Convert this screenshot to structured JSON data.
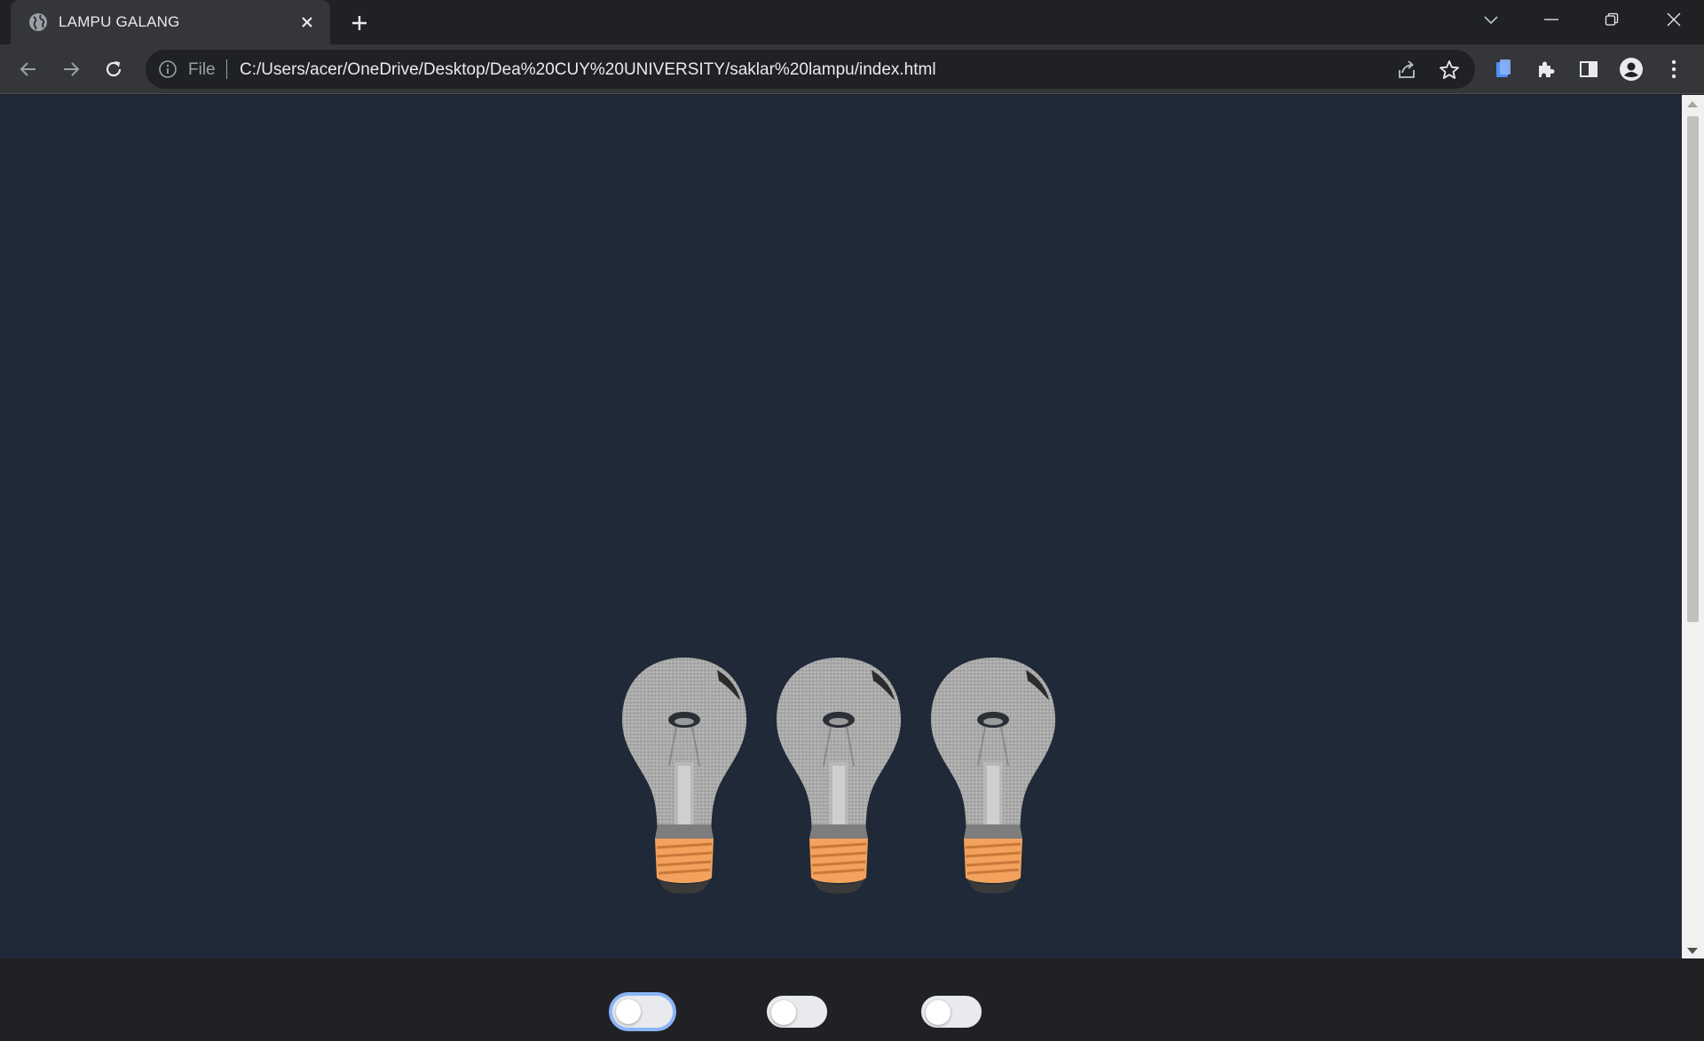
{
  "browser": {
    "tab_title": "LAMPU GALANG",
    "address_scheme": "File",
    "address_url": "C:/Users/acer/OneDrive/Desktop/Dea%20CUY%20UNIVERSITY/saklar%20lampu/index.html",
    "icons": {
      "tab": "globe-icon",
      "close": "close-icon",
      "new_tab": "plus-icon",
      "back": "arrow-left-icon",
      "forward": "arrow-right-icon",
      "reload": "reload-icon",
      "site_info": "info-icon",
      "share": "share-icon",
      "bookmark": "star-icon",
      "extension_1": "document-icon",
      "extensions": "puzzle-icon",
      "side_panel": "side-panel-icon",
      "profile": "profile-icon",
      "menu": "kebab-menu-icon",
      "tab_search": "chevron-down-icon",
      "minimize": "minimize-icon",
      "restore": "restore-icon",
      "window_close": "close-icon"
    }
  },
  "page": {
    "background": "#1f2937",
    "lamps": [
      {
        "state": "off",
        "switch_on": false,
        "switch_focused": true
      },
      {
        "state": "off",
        "switch_on": false,
        "switch_focused": false
      },
      {
        "state": "off",
        "switch_on": false,
        "switch_focused": false
      }
    ]
  }
}
